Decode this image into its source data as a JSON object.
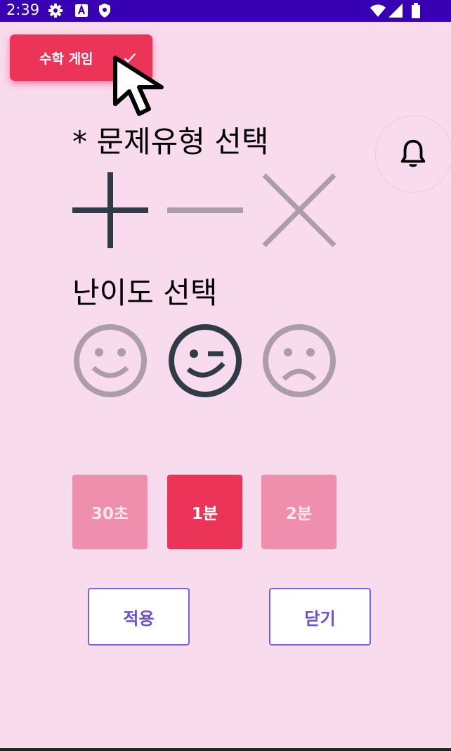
{
  "status_bar": {
    "time": "2:39",
    "icons": [
      "gear-icon",
      "a-badge-icon",
      "shield-icon",
      "wifi-icon",
      "signal-icon",
      "battery-icon"
    ]
  },
  "header": {
    "game_selector_label": "수학 게임",
    "game_selector_icon": "check-icon"
  },
  "notification": {
    "icon": "bell-icon"
  },
  "operation": {
    "title": "* 문제유형 선택",
    "options": [
      {
        "icon": "plus-icon",
        "selected": true
      },
      {
        "icon": "minus-icon",
        "selected": false
      },
      {
        "icon": "multiply-icon",
        "selected": false
      }
    ]
  },
  "difficulty": {
    "title": "난이도 선택",
    "options": [
      {
        "icon": "smile-face-icon",
        "selected": false
      },
      {
        "icon": "wink-face-icon",
        "selected": true
      },
      {
        "icon": "sad-face-icon",
        "selected": false
      }
    ]
  },
  "time": {
    "options": [
      {
        "label": "30초",
        "selected": false
      },
      {
        "label": "1분",
        "selected": true
      },
      {
        "label": "2분",
        "selected": false
      }
    ]
  },
  "actions": {
    "apply_label": "적용",
    "close_label": "닫기"
  },
  "colors": {
    "background": "#f9dbee",
    "status_bar": "#3700b3",
    "accent": "#ec3358",
    "accent_dim": "#f08fad",
    "button_border": "#7a5ff0"
  }
}
